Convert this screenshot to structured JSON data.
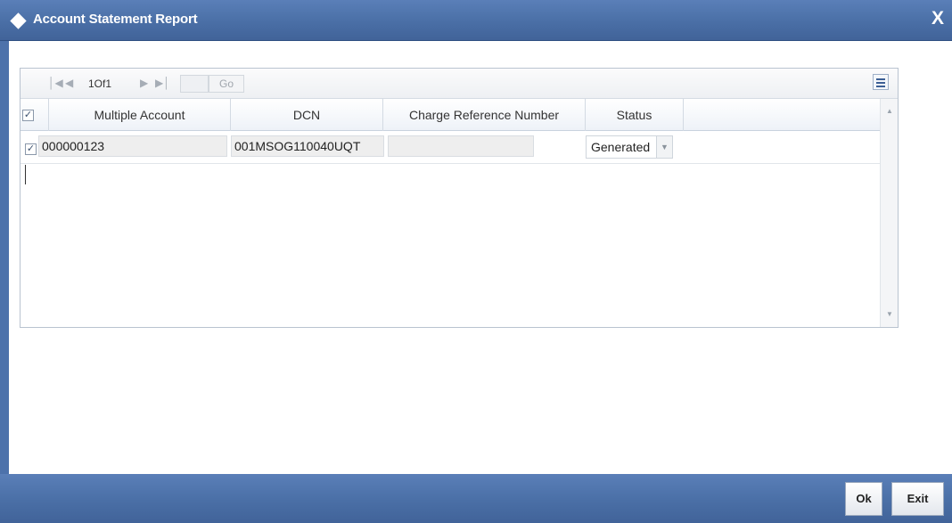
{
  "window": {
    "title": "Account Statement Report",
    "close_label": "X"
  },
  "toolbar": {
    "first_icon": "first-page-icon",
    "prev_icon": "previous-page-icon",
    "page_info": "1Of1",
    "next_icon": "next-page-icon",
    "last_icon": "last-page-icon",
    "page_input_value": "",
    "go_label": "Go",
    "settings_icon": "column-settings-icon"
  },
  "table": {
    "header_all_checked": true,
    "columns": [
      "Multiple Account",
      "DCN",
      "Charge Reference Number",
      "Status"
    ],
    "rows": [
      {
        "checked": true,
        "multiple_account": "000000123",
        "dcn": "001MSOG110040UQT",
        "charge_reference_number": "",
        "status": "Generated"
      }
    ]
  },
  "footer": {
    "ok_label": "Ok",
    "exit_label": "Exit"
  },
  "colors": {
    "titlebar": "#4a6fa6",
    "footer": "#4a6fa6",
    "grid_border": "#b9c3d0"
  }
}
